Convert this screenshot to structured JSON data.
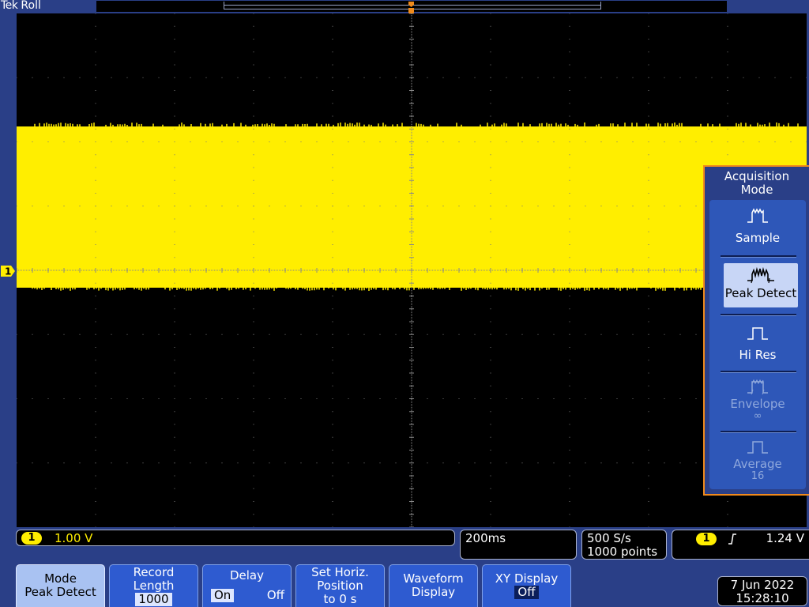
{
  "header": {
    "brand": "Tek",
    "acq_state": "Roll"
  },
  "channel": {
    "marker": "1"
  },
  "acquisition_menu": {
    "title_line1": "Acquisition",
    "title_line2": "Mode",
    "items": [
      {
        "label": "Sample",
        "sub": "",
        "icon": "sample-waveform-icon",
        "state": "normal"
      },
      {
        "label": "Peak Detect",
        "sub": "",
        "icon": "peak-detect-waveform-icon",
        "state": "selected"
      },
      {
        "label": "Hi Res",
        "sub": "",
        "icon": "hi-res-waveform-icon",
        "state": "normal"
      },
      {
        "label": "Envelope",
        "sub": "∞",
        "icon": "envelope-waveform-icon",
        "state": "disabled"
      },
      {
        "label": "Average",
        "sub": "16",
        "icon": "average-waveform-icon",
        "state": "disabled"
      }
    ]
  },
  "readouts": {
    "ch1_badge": "1",
    "ch1_scale": "1.00 V",
    "horizontal_scale": "200ms",
    "sample_rate": "500 S/s",
    "record_points": "1000 points",
    "trigger_badge": "1",
    "trigger_slope_icon": "rising-edge-icon",
    "trigger_level": "1.24 V"
  },
  "bottom_menu": {
    "mode_label": "Mode",
    "mode_value": "Peak Detect",
    "record_length_label_1": "Record",
    "record_length_label_2": "Length",
    "record_length_value": "1000",
    "delay_label": "Delay",
    "delay_on": "On",
    "delay_off": "Off",
    "set_horiz_1": "Set Horiz.",
    "set_horiz_2": "Position",
    "set_horiz_3": "to 0 s",
    "waveform_display_1": "Waveform",
    "waveform_display_2": "Display",
    "xy_display_label": "XY Display",
    "xy_display_value": "Off"
  },
  "datetime": {
    "date": "7 Jun 2022",
    "time": "15:28:10"
  },
  "colors": {
    "background": "#2a3f87",
    "trace_ch1": "#ffee00",
    "menu_accent": "#f08a1c",
    "button": "#2e5bd0"
  }
}
